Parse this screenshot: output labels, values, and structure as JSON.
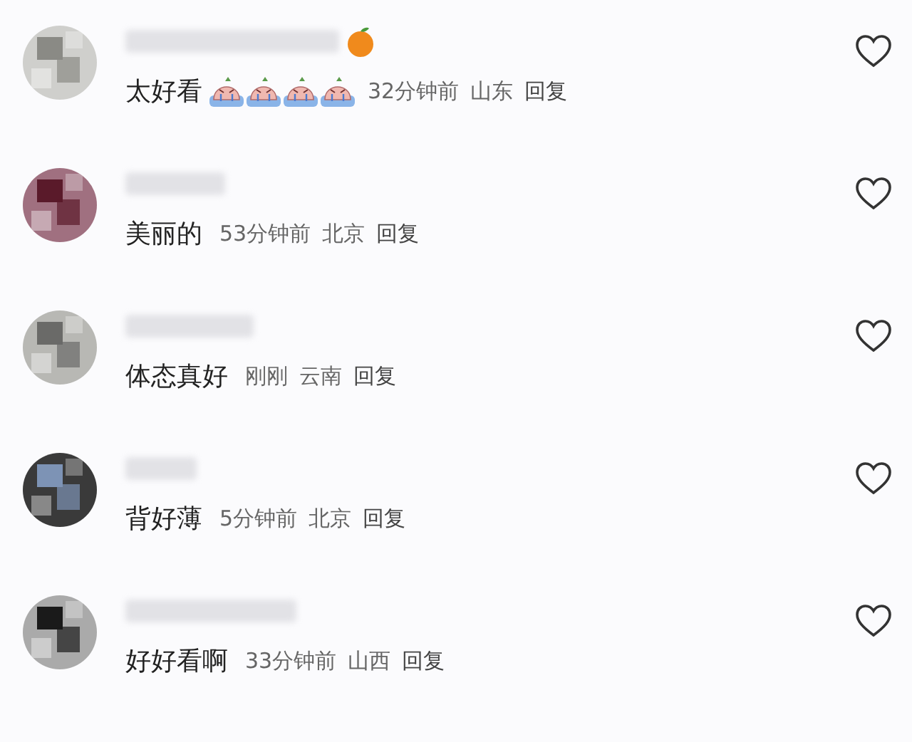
{
  "comments": [
    {
      "name_badge": {
        "kind": "orange"
      },
      "text": "太好看",
      "stickers": [
        {
          "kind": "crying-face"
        },
        {
          "kind": "crying-face"
        },
        {
          "kind": "crying-face"
        },
        {
          "kind": "crying-face"
        }
      ],
      "time": "32分钟前",
      "location": "山东",
      "reply": "回复",
      "liked": false
    },
    {
      "text": "美丽的",
      "time": "53分钟前",
      "location": "北京",
      "reply": "回复",
      "liked": false
    },
    {
      "text": "体态真好",
      "time": "刚刚",
      "location": "云南",
      "reply": "回复",
      "liked": false
    },
    {
      "text": "背好薄",
      "time": "5分钟前",
      "location": "北京",
      "reply": "回复",
      "liked": false
    },
    {
      "text": "好好看啊",
      "time": "33分钟前",
      "location": "山西",
      "reply": "回复",
      "liked": false
    }
  ]
}
